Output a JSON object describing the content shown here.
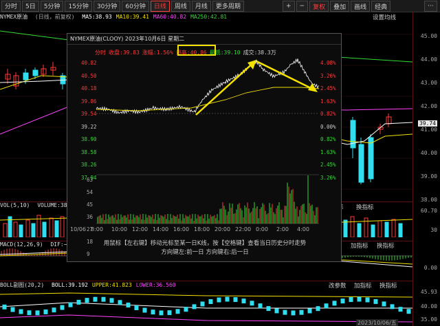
{
  "toolbar": {
    "tabs": [
      {
        "label": "分时",
        "active": false
      },
      {
        "label": "5日",
        "active": false,
        "dropdown": true
      },
      {
        "label": "5分钟",
        "active": false
      },
      {
        "label": "15分钟",
        "active": false
      },
      {
        "label": "30分钟",
        "active": false
      },
      {
        "label": "60分钟",
        "active": false
      },
      {
        "label": "日线",
        "active": true
      },
      {
        "label": "周线",
        "active": false
      },
      {
        "label": "月线",
        "active": false
      },
      {
        "label": "更多周期",
        "active": false,
        "dropdown": true
      }
    ],
    "right": [
      "+",
      "−",
      "复权",
      "叠加",
      "画线",
      "经典"
    ],
    "more_label": "···"
  },
  "main": {
    "symbol": "NYMEX原油",
    "mode": "(日线，前复权)",
    "ma": [
      {
        "label": "MA5:38.93",
        "color": "#ffffff"
      },
      {
        "label": "MA10:39.41",
        "color": "#f3e100"
      },
      {
        "label": "MA60:40.82",
        "color": "#ff44ff"
      },
      {
        "label": "MA250:42.81",
        "color": "#33dd33"
      }
    ],
    "settings_label": "设置均线",
    "axis": [
      "45.00",
      "44.00",
      "43.00",
      "42.00",
      "41.00",
      "40.00",
      "39.00",
      "38.00"
    ],
    "last_price": "39.74"
  },
  "vol": {
    "label": "VOL(5,10)",
    "value": "VOLUME:38",
    "axis": [
      "60.70",
      "30"
    ]
  },
  "macd": {
    "label": "MACD(12,26,9)",
    "value": "DIF:−",
    "axis": [
      "0.00"
    ]
  },
  "boll": {
    "label": "BOLL副图(20,2)",
    "values": [
      {
        "label": "BOLL:39.192",
        "color": "#ffffff"
      },
      {
        "label": "UPPER:41.823",
        "color": "#f3e100"
      },
      {
        "label": "LOWER:36.560",
        "color": "#ff44ff"
      }
    ],
    "axis": [
      "45.93",
      "40.00",
      "35.00"
    ],
    "date": "2023/10/06/五"
  },
  "side_buttons": {
    "params": "改参数",
    "add_indicator": "加指标",
    "change_indicator": "换指标"
  },
  "popup": {
    "title": "NYMEX原油(CLOOY)  2023年10月6日 星期二",
    "info": [
      {
        "label": "分时",
        "color": "#ff3a3a"
      },
      {
        "label": "收盘:39.83",
        "color": "#ff3a3a"
      },
      {
        "label": "涨幅:1.56%",
        "color": "#ff3a3a"
      },
      {
        "label": "最高:40.86",
        "color": "#ff3a3a"
      },
      {
        "label": "最低:39.10",
        "color": "#33dd33"
      },
      {
        "label": "成交:38.3万",
        "color": "#cccccc"
      }
    ],
    "left_axis": [
      {
        "v": "40.82",
        "c": "#ff3a3a"
      },
      {
        "v": "40.50",
        "c": "#ff3a3a"
      },
      {
        "v": "40.18",
        "c": "#ff3a3a"
      },
      {
        "v": "39.86",
        "c": "#ff3a3a"
      },
      {
        "v": "39.54",
        "c": "#ff3a3a"
      },
      {
        "v": "39.22",
        "c": "#cccccc"
      },
      {
        "v": "38.90",
        "c": "#33dd33"
      },
      {
        "v": "38.58",
        "c": "#33dd33"
      },
      {
        "v": "38.26",
        "c": "#33dd33"
      },
      {
        "v": "37.94",
        "c": "#33dd33"
      }
    ],
    "right_axis": [
      {
        "v": "4.08%",
        "c": "#ff3a3a"
      },
      {
        "v": "3.26%",
        "c": "#ff3a3a"
      },
      {
        "v": "2.45%",
        "c": "#ff3a3a"
      },
      {
        "v": "1.63%",
        "c": "#ff3a3a"
      },
      {
        "v": "0.82%",
        "c": "#ff3a3a"
      },
      {
        "v": "0.00%",
        "c": "#cccccc"
      },
      {
        "v": "0.82%",
        "c": "#33dd33"
      },
      {
        "v": "1.63%",
        "c": "#33dd33"
      },
      {
        "v": "2.45%",
        "c": "#33dd33"
      },
      {
        "v": "3.26%",
        "c": "#33dd33"
      }
    ],
    "vol_axis": [
      "63",
      "54",
      "45",
      "36",
      "27",
      "18",
      "9"
    ],
    "vol_axis_tail": "21",
    "x_ticks": [
      "10/06",
      "8:00",
      "10:00",
      "12:00",
      "14:00",
      "16:00",
      "18:00",
      "20:00",
      "22:00",
      "0:00",
      "2:00",
      "4:00"
    ],
    "hint1": "用鼠标【左右键】移动光标至某一日K线，按【空格键】查看当日历史分时走势",
    "hint2": "方向键左:前一日    方向键右:后一日"
  }
}
